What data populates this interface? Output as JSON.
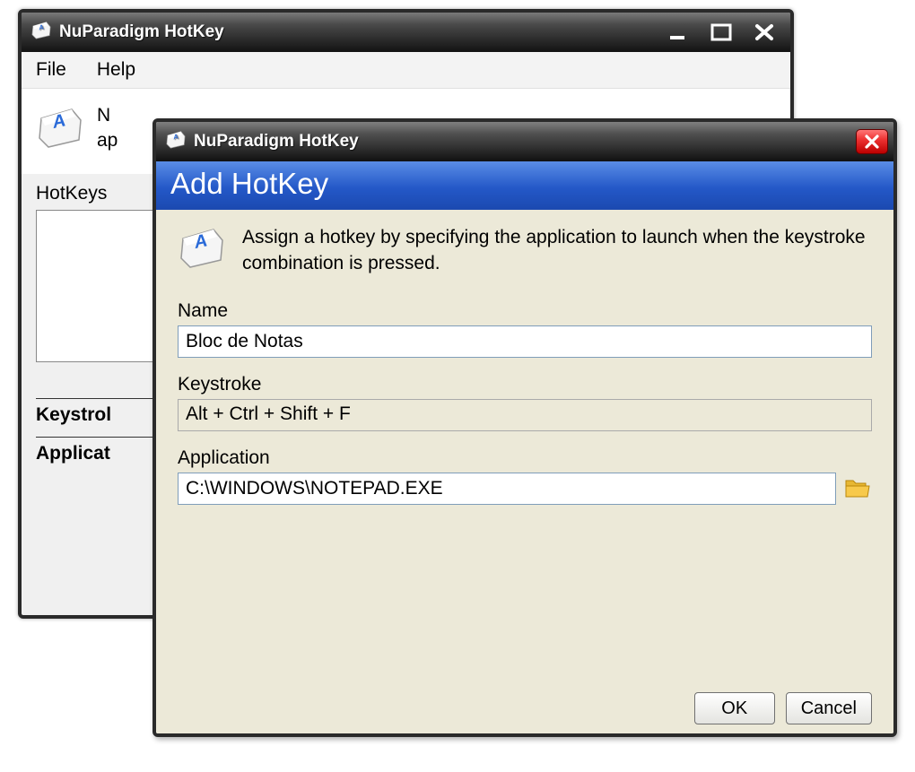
{
  "parent_window": {
    "title": "NuParadigm HotKey",
    "menu": {
      "file": "File",
      "help": "Help"
    },
    "desc1_prefix": "N",
    "desc2_prefix": "ap",
    "hotkeys_label": "HotKeys",
    "keystroke_label": "Keystrol",
    "application_label": "Applicat"
  },
  "dialog": {
    "title": "NuParadigm HotKey",
    "header": "Add HotKey",
    "description": "Assign a hotkey by specifying the application to launch when the keystroke combination is pressed.",
    "name_label": "Name",
    "name_value": "Bloc de Notas",
    "keystroke_label": "Keystroke",
    "keystroke_value": "Alt + Ctrl + Shift + F",
    "application_label": "Application",
    "application_value": "C:\\WINDOWS\\NOTEPAD.EXE",
    "ok_label": "OK",
    "cancel_label": "Cancel"
  }
}
